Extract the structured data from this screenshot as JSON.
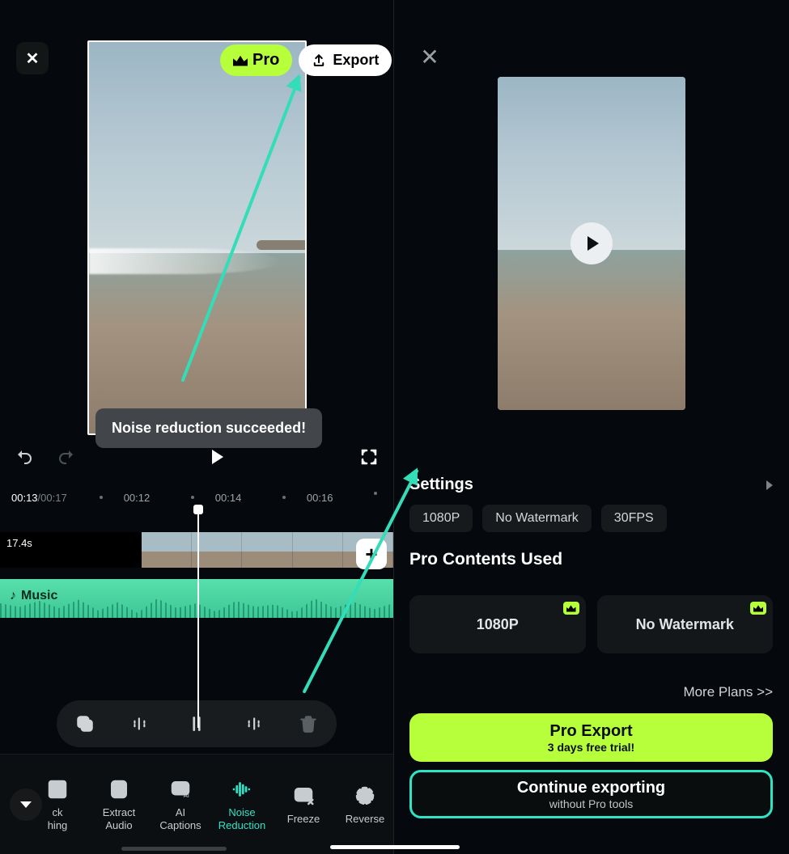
{
  "left": {
    "pro_label": "Pro",
    "export_label": "Export",
    "toast": "Noise reduction succeeded!",
    "time_current": "00:13",
    "time_total": "/00:17",
    "ticks": [
      "00:12",
      "00:14",
      "00:16"
    ],
    "clip_duration": "17.4s",
    "audio_label": "Music",
    "bottom_tools": {
      "cut_line1": "ck",
      "cut_line2": "hing",
      "extract_line1": "Extract",
      "extract_line2": "Audio",
      "ai_line1": "AI",
      "ai_line2": "Captions",
      "noise_line1": "Noise",
      "noise_line2": "Reduction",
      "freeze": "Freeze",
      "reverse": "Reverse"
    }
  },
  "right": {
    "settings_label": "Settings",
    "chips": {
      "res": "1080P",
      "wm": "No Watermark",
      "fps": "30FPS"
    },
    "pro_contents_label": "Pro Contents Used",
    "cards": {
      "c1": "1080P",
      "c2": "No Watermark"
    },
    "more_plans": "More Plans >>",
    "pro_export": {
      "t1": "Pro Export",
      "t2": "3 days free trial!"
    },
    "cont_export": {
      "t1": "Continue exporting",
      "t2": "without Pro tools"
    }
  }
}
